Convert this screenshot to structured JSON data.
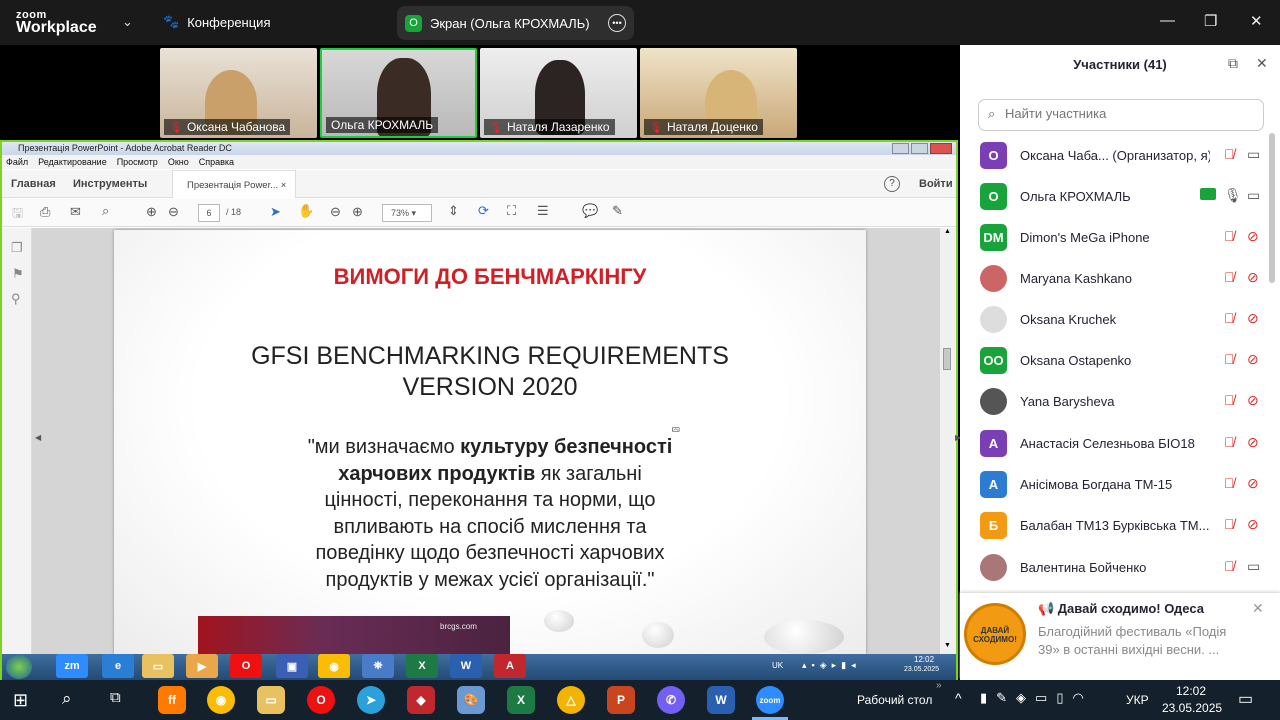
{
  "app": {
    "logo_top": "zoom",
    "logo_bottom": "Workplace",
    "meeting_label": "Конференция",
    "share_label": "Экран (Ольга КРОХМАЛЬ)",
    "share_badge": "O"
  },
  "gallery": [
    {
      "name": "Оксана Чабанова"
    },
    {
      "name": "Ольга КРОХМАЛЬ"
    },
    {
      "name": "Наталя Лазаренко"
    },
    {
      "name": "Наталя Доценко"
    }
  ],
  "acrobat": {
    "title": "Презентація PowerPoint - Adobe Acrobat Reader DC",
    "menu": [
      "Файл",
      "Редактирование",
      "Просмотр",
      "Окно",
      "Справка"
    ],
    "tabs": {
      "home": "Главная",
      "tools": "Инструменты",
      "doc": "Презентація Power..."
    },
    "login": "Войти",
    "page_current": "6",
    "page_total": "/ 18",
    "zoom": "73%"
  },
  "slide": {
    "title": "ВИМОГИ ДО БЕНЧМАРКІНГУ",
    "subtitle1": "GFSI BENCHMARKING REQUIREMENTS",
    "subtitle2": "VERSION 2020",
    "q1": "\"ми визначаємо ",
    "q1b": "культуру безпечності",
    "q2b": "харчових продуктів",
    "q2": " як загальні",
    "q3": "цінності, переконання та норми, що",
    "q4": "впливають на спосіб мислення та",
    "q5": "поведінку щодо безпечності харчових",
    "q6": "продуктів у межах усієї організації.\"",
    "watermark": "brcgs.com"
  },
  "panel": {
    "title": "Участники (41)",
    "search_placeholder": "Найти участника",
    "participants": [
      {
        "initials": "О",
        "color": "#7b3fb5",
        "name": "Оксана Чаба...  (Организатор, я)"
      },
      {
        "initials": "О",
        "color": "#19a33b",
        "name": "Ольга КРОХМАЛЬ"
      },
      {
        "initials": "DM",
        "color": "#19a33b",
        "name": "Dimon's MeGa iPhone"
      },
      {
        "initials": "",
        "color": "#c66",
        "name": "Maryana Kashkano"
      },
      {
        "initials": "",
        "color": "#ddd",
        "name": "Oksana Kruchek"
      },
      {
        "initials": "OO",
        "color": "#19a33b",
        "name": "Oksana Ostapenko"
      },
      {
        "initials": "",
        "color": "#555",
        "name": "Yana Barysheva"
      },
      {
        "initials": "А",
        "color": "#7b3fb5",
        "name": "Анастасія Селезньова БІО18"
      },
      {
        "initials": "А",
        "color": "#2d7cd3",
        "name": "Анісімова Богдана ТМ-15"
      },
      {
        "initials": "Б",
        "color": "#f29b12",
        "name": "Балабан ТМ13 Бурківська ТМ..."
      },
      {
        "initials": "",
        "color": "#a77",
        "name": "Валентина Бойченко"
      }
    ],
    "notify": {
      "title": "📢 Давай сходимо! Одеса",
      "body1": "Благодійний фестиваль «Подія",
      "body2": "39» в останні вихідні весни. ..."
    }
  },
  "win7tray": {
    "lang": "UK",
    "time": "12:02",
    "date": "23.05.2025"
  },
  "taskbar": {
    "desktop": "Рабочий стол",
    "lang": "УКР",
    "time": "12:02",
    "date": "23.05.2025"
  }
}
